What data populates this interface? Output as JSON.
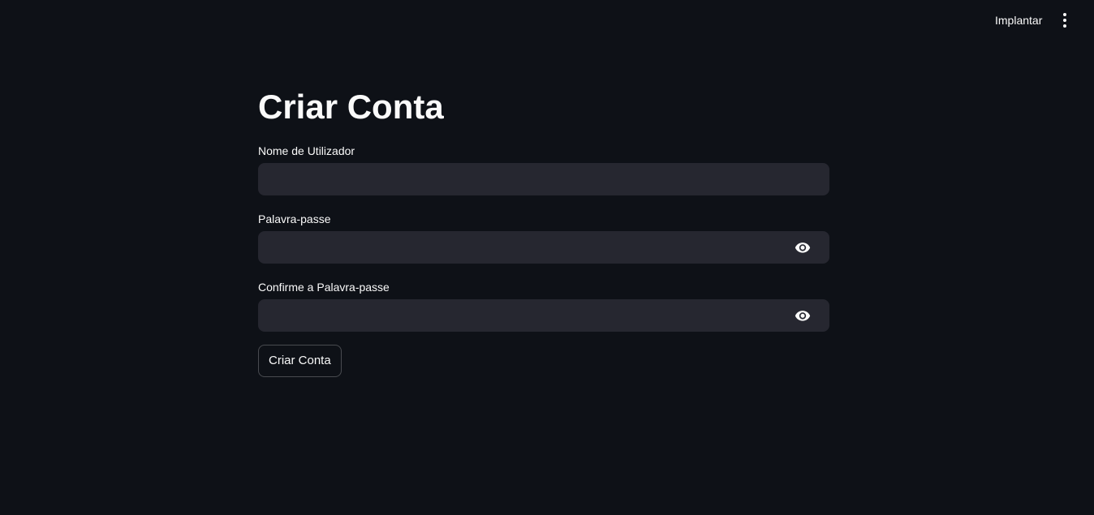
{
  "header": {
    "deploy_label": "Implantar",
    "menu_icon": "vertical-dots-icon"
  },
  "page": {
    "title": "Criar Conta"
  },
  "form": {
    "username": {
      "label": "Nome de Utilizador",
      "value": "",
      "placeholder": ""
    },
    "password": {
      "label": "Palavra-passe",
      "value": "",
      "placeholder": "",
      "icon": "eye-icon"
    },
    "confirm_password": {
      "label": "Confirme a Palavra-passe",
      "value": "",
      "placeholder": "",
      "icon": "eye-icon"
    },
    "submit_label": "Criar Conta"
  },
  "colors": {
    "background": "#0e1117",
    "input_background": "#262730",
    "text": "#fafafa"
  }
}
